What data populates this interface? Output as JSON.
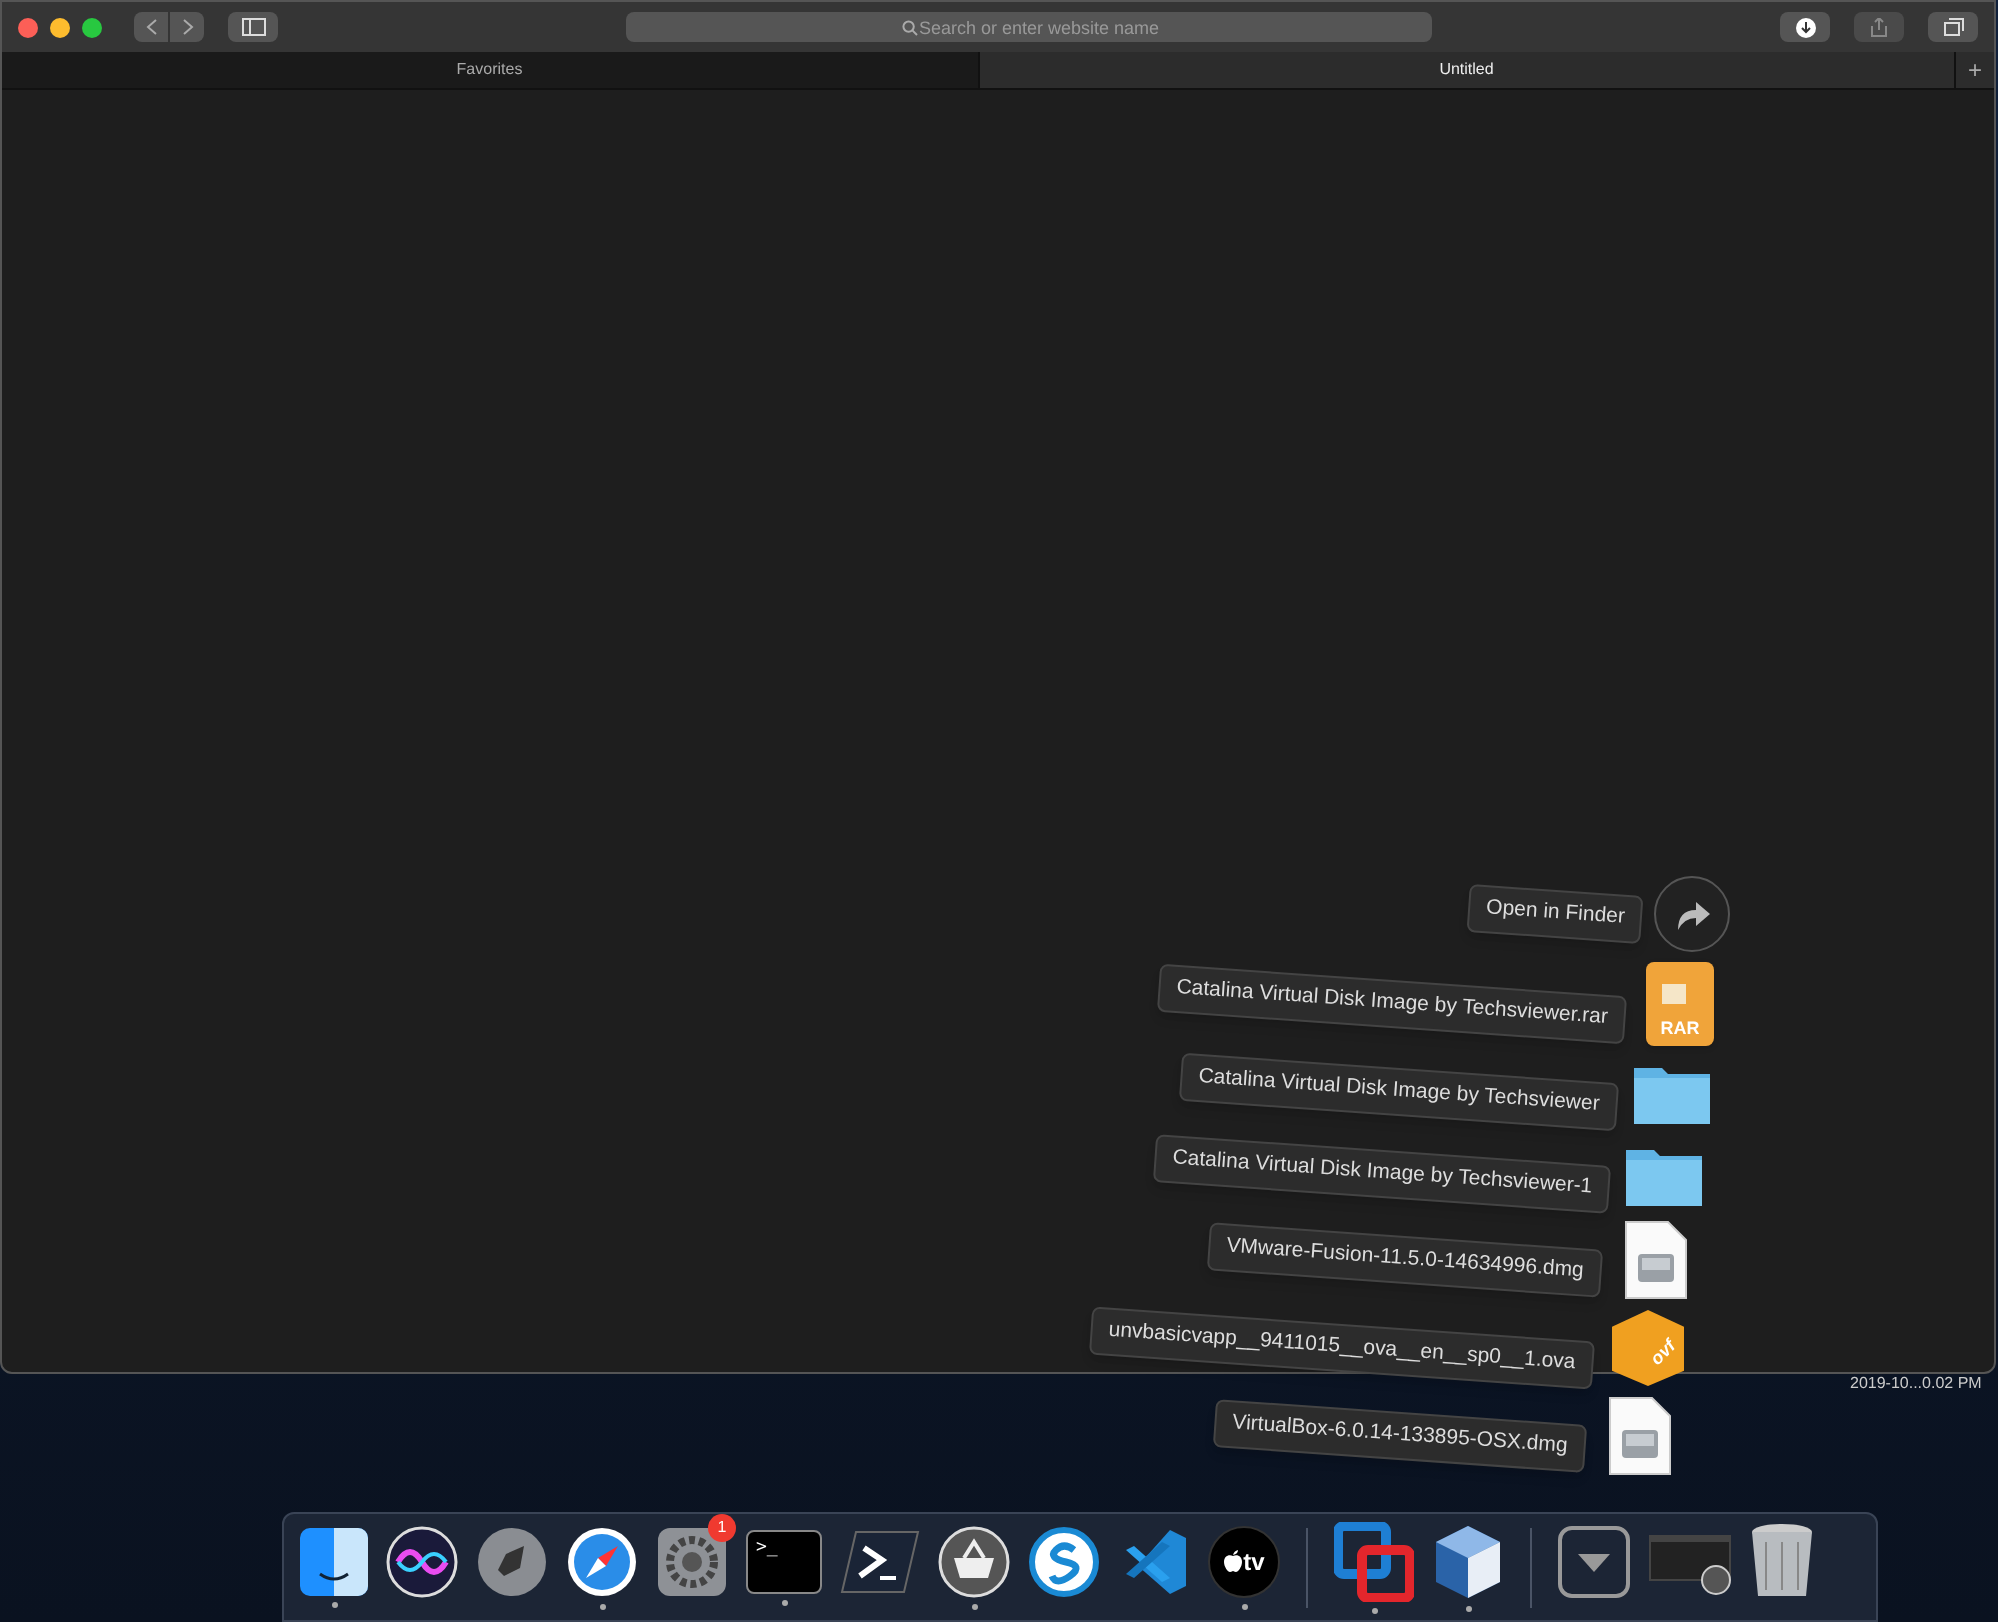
{
  "window": {
    "search": {
      "placeholder": "Search or enter website name"
    },
    "tabs": [
      {
        "label": "Favorites",
        "selected": false
      },
      {
        "label": "Untitled",
        "selected": true
      }
    ],
    "new_tab": "+"
  },
  "desktop": {
    "timestamp": "2019-10...0.02 PM"
  },
  "stack": {
    "open_in_finder": "Open in Finder",
    "items": [
      {
        "kind": "rar",
        "name": "Catalina Virtual Disk Image by Techsviewer.rar",
        "icon_text": "RAR"
      },
      {
        "kind": "folder",
        "name": "Catalina Virtual Disk Image by Techsviewer"
      },
      {
        "kind": "folder",
        "name": "Catalina Virtual Disk Image by Techsviewer-1"
      },
      {
        "kind": "dmg",
        "name": "VMware-Fusion-11.5.0-14634996.dmg"
      },
      {
        "kind": "ova",
        "name": "unvbasicvapp__9411015__ova__en__sp0__1.ova",
        "icon_text": "ovf"
      },
      {
        "kind": "dmg",
        "name": "VirtualBox-6.0.14-133895-OSX.dmg"
      }
    ]
  },
  "dock": {
    "items": [
      {
        "kind": "finder",
        "running": true
      },
      {
        "kind": "siri",
        "running": false
      },
      {
        "kind": "launchpad",
        "running": false
      },
      {
        "kind": "safari",
        "running": true
      },
      {
        "kind": "prefs",
        "running": false,
        "badge": "1"
      },
      {
        "kind": "terminal",
        "running": true,
        "icon_text": ">_"
      },
      {
        "kind": "powershell",
        "running": false
      },
      {
        "kind": "basket",
        "running": true
      },
      {
        "kind": "skype",
        "running": false
      },
      {
        "kind": "vscode",
        "running": false
      },
      {
        "kind": "tv",
        "running": true,
        "icon_text": "tv"
      },
      {
        "kind": "divider"
      },
      {
        "kind": "vmware",
        "running": true
      },
      {
        "kind": "virtualbox",
        "running": true
      },
      {
        "kind": "divider"
      },
      {
        "kind": "downloads",
        "running": false
      },
      {
        "kind": "screenshot",
        "running": false
      },
      {
        "kind": "trash",
        "running": false
      }
    ]
  }
}
